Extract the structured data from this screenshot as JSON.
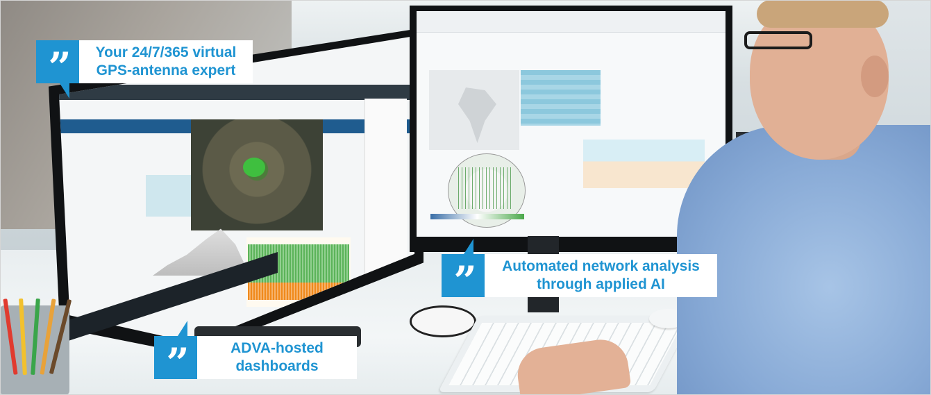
{
  "callouts": {
    "virtual_expert": {
      "line1": "Your 24/7/365 virtual",
      "line2": "GPS-antenna expert"
    },
    "ai_analysis": {
      "line1": "Automated network analysis",
      "line2": "through applied AI"
    },
    "dashboards": {
      "line1": "ADVA-hosted",
      "line2": "dashboards"
    }
  },
  "icons": {
    "quote_glyph": "”",
    "quote_icon": "quote-icon"
  },
  "colors": {
    "accent": "#1f94d2",
    "callout_bg": "#ffffff"
  }
}
